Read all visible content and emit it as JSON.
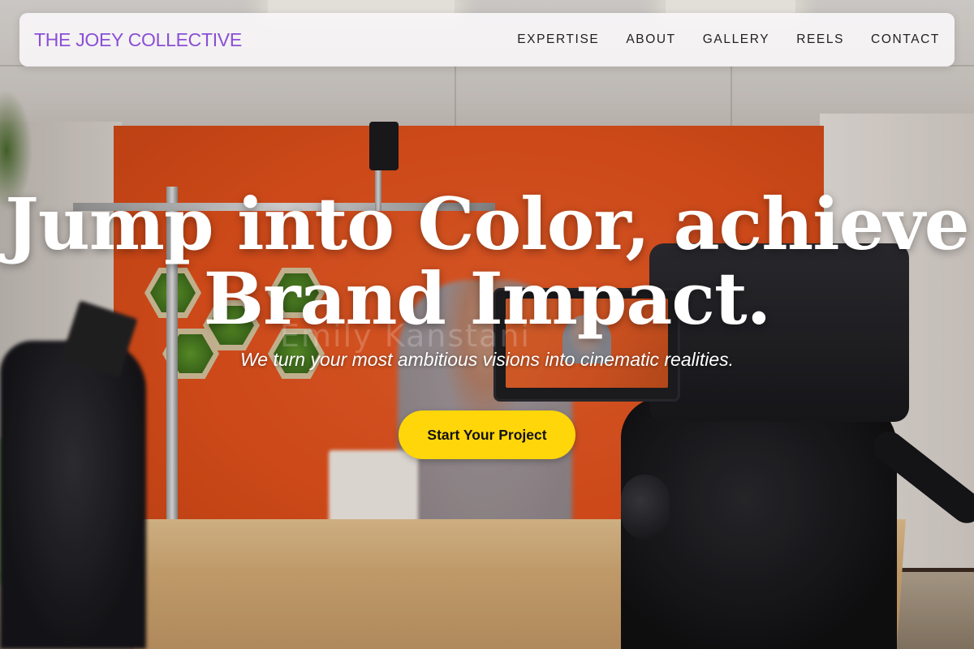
{
  "brand": {
    "name": "THE JOEY COLLECTIVE"
  },
  "nav": {
    "items": [
      {
        "label": "EXPERTISE"
      },
      {
        "label": "ABOUT"
      },
      {
        "label": "GALLERY"
      },
      {
        "label": "REELS"
      },
      {
        "label": "CONTACT"
      }
    ]
  },
  "hero": {
    "headline_line1": "Jump into Color, achieve",
    "headline_line2": "Brand Impact.",
    "subheadline": "We turn your most ambitious visions into cinematic realities.",
    "cta_label": "Start Your Project",
    "background_watermark": "Emily Kanstani"
  },
  "colors": {
    "brand_purple": "#8a4fd6",
    "cta_yellow": "#ffd60a",
    "nav_text": "#222222",
    "headline": "#ffffff"
  }
}
